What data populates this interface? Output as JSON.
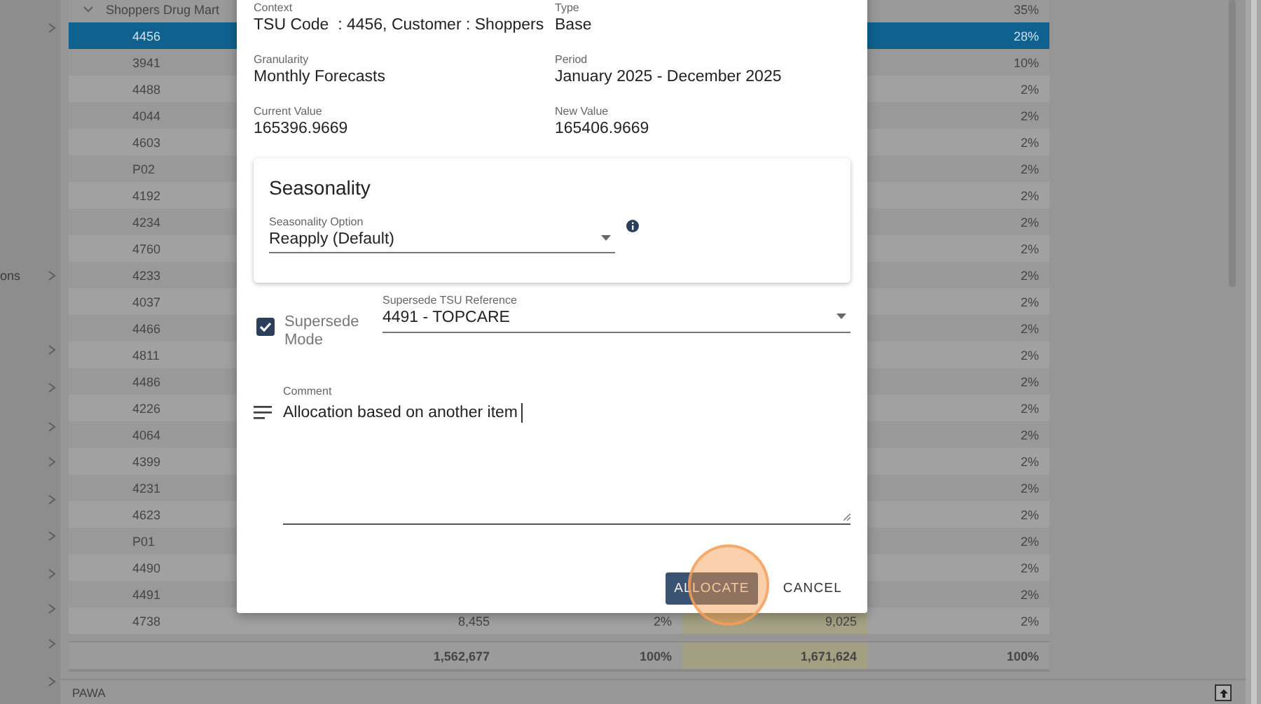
{
  "sidebar": {
    "items": [
      {
        "label": "ons"
      }
    ]
  },
  "table": {
    "group": {
      "label": "Shoppers Drug Mart",
      "expanded": true,
      "share": "35%"
    },
    "rows": [
      {
        "code": "4456",
        "share": "28%",
        "selected": true
      },
      {
        "code": "3941",
        "share": "10%",
        "selected": false
      },
      {
        "code": "4488",
        "share": "2%",
        "selected": false
      },
      {
        "code": "4044",
        "share": "2%",
        "selected": false
      },
      {
        "code": "4603",
        "share": "2%",
        "selected": false
      },
      {
        "code": "P02",
        "share": "2%",
        "selected": false
      },
      {
        "code": "4192",
        "share": "2%",
        "selected": false
      },
      {
        "code": "4234",
        "share": "2%",
        "selected": false
      },
      {
        "code": "4760",
        "share": "2%",
        "selected": false
      },
      {
        "code": "4233",
        "share": "2%",
        "selected": false
      },
      {
        "code": "4037",
        "share": "2%",
        "selected": false
      },
      {
        "code": "4466",
        "share": "2%",
        "selected": false
      },
      {
        "code": "4811",
        "share": "2%",
        "selected": false
      },
      {
        "code": "4486",
        "share": "2%",
        "selected": false
      },
      {
        "code": "4226",
        "share": "2%",
        "selected": false
      },
      {
        "code": "4064",
        "share": "2%",
        "selected": false
      },
      {
        "code": "4399",
        "share": "2%",
        "selected": false
      },
      {
        "code": "4231",
        "share": "2%",
        "selected": false
      },
      {
        "code": "4623",
        "share": "2%",
        "selected": false
      },
      {
        "code": "P01",
        "share": "2%",
        "selected": false
      },
      {
        "code": "4490",
        "share": "2%",
        "selected": false
      },
      {
        "code": "4491",
        "share": "2%",
        "selected": false
      },
      {
        "code": "4738",
        "column_2": "8,455",
        "column_3": "2%",
        "column_4": "9,025",
        "share": "2%",
        "selected": false
      }
    ],
    "totals": {
      "column_2": "1,562,677",
      "column_3": "100%",
      "column_4": "1,671,624",
      "share": "100%"
    }
  },
  "bottom_bar": {
    "label": "PAWA"
  },
  "dialog": {
    "fields": [
      {
        "label": "Context",
        "value": "TSU Code  : 4456, Customer : Shoppers"
      },
      {
        "label": "Type",
        "value": "Base"
      },
      {
        "label": "Granularity",
        "value": "Monthly Forecasts"
      },
      {
        "label": "Period",
        "value": "January 2025 - December 2025"
      },
      {
        "label": "Current Value",
        "value": "165396.9669"
      },
      {
        "label": "New Value",
        "value": "165406.9669"
      }
    ],
    "seasonality": {
      "title": "Seasonality",
      "label": "Seasonality Option",
      "value": "Reapply (Default)"
    },
    "supersede": {
      "label": "Supersede Mode",
      "checked": true,
      "reference_label": "Supersede TSU Reference",
      "reference_value": "4491 - TOPCARE"
    },
    "comment": {
      "label": "Comment",
      "value": "Allocation based on another item"
    },
    "buttons": [
      {
        "label": "ALLOCATE",
        "kind": "primary"
      },
      {
        "label": "CANCEL",
        "kind": "text"
      }
    ]
  }
}
